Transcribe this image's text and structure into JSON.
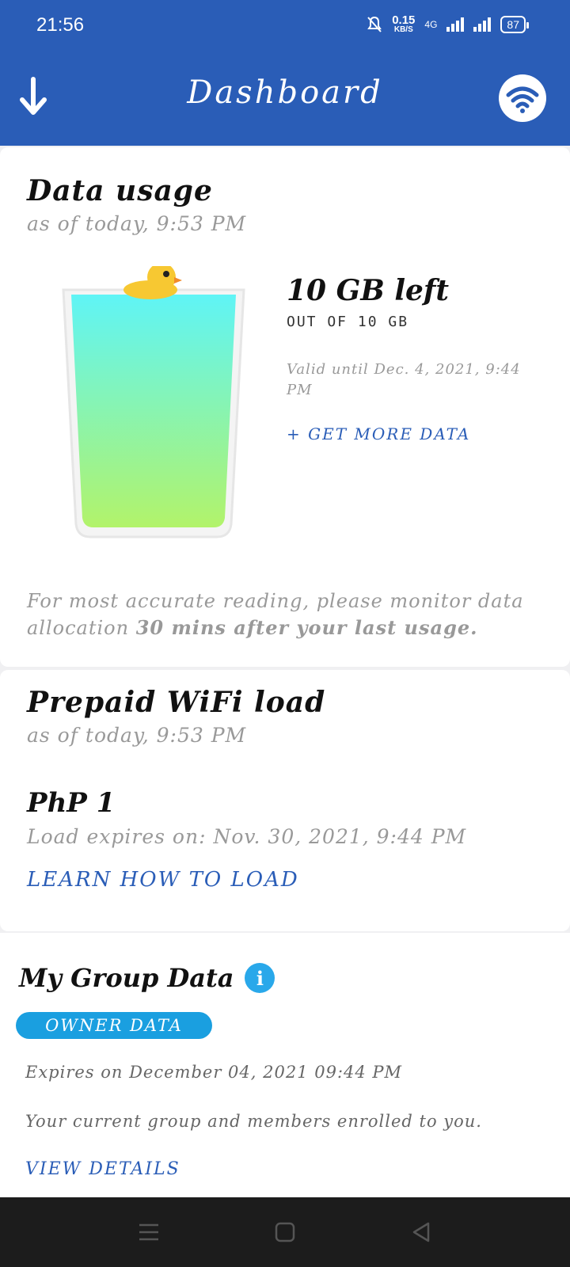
{
  "statusbar": {
    "time": "21:56",
    "speed_value": "0.15",
    "speed_unit": "KB/S",
    "network": "4G",
    "battery": "87"
  },
  "header": {
    "title": "Dashboard",
    "back_icon": "arrow-down-icon",
    "logo_icon": "wifi-logo-icon"
  },
  "data_usage": {
    "title": "Data usage",
    "as_of": "as of today, 9:53 PM",
    "left": "10 GB left",
    "out_of": "OUT OF 10 GB",
    "valid_until": "Valid until Dec. 4, 2021, 9:44 PM",
    "get_more": "+ GET MORE DATA",
    "note_prefix": "For most accurate reading, please monitor data allocation ",
    "note_bold": "30 mins after your last usage.",
    "remaining_fraction": 1.0
  },
  "prepaid": {
    "title": "Prepaid WiFi load",
    "as_of": "as of today, 9:53 PM",
    "amount": "PhP 1",
    "expires": "Load expires on: Nov. 30, 2021, 9:44 PM",
    "learn": "LEARN HOW TO LOAD"
  },
  "group": {
    "title": "My Group Data",
    "info_icon": "i",
    "badge": "OWNER DATA",
    "expires": "Expires on December 04, 2021 09:44 PM",
    "description": "Your current group and members enrolled to you.",
    "view_details": "VIEW DETAILS"
  },
  "navbar": {
    "menu_icon": "menu-icon",
    "home_icon": "home-icon",
    "back_icon": "back-icon"
  },
  "colors": {
    "primary": "#2a5db7",
    "accent": "#1a9fe0",
    "water_top": "#5ff4f6",
    "water_bottom": "#b2f36a"
  }
}
